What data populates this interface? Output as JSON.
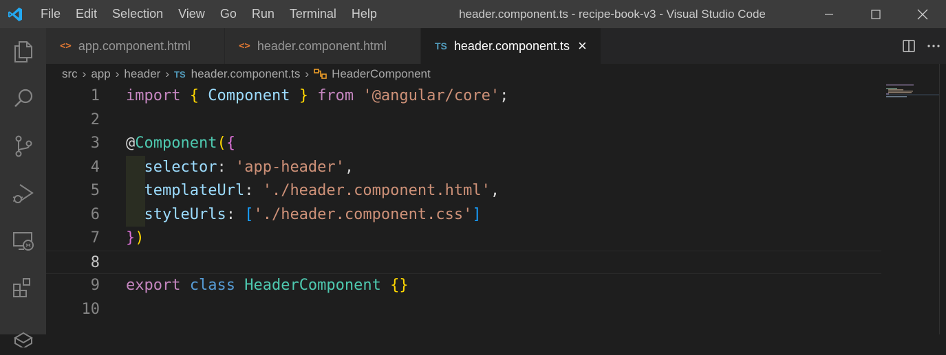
{
  "titlebar": {
    "menu": [
      "File",
      "Edit",
      "Selection",
      "View",
      "Go",
      "Run",
      "Terminal",
      "Help"
    ],
    "window_title": "header.component.ts - recipe-book-v3 - Visual Studio Code"
  },
  "activity_bar": {
    "icons": [
      "explorer-icon",
      "search-icon",
      "source-control-icon",
      "run-debug-icon",
      "remote-explorer-icon",
      "extensions-icon",
      "docker-icon"
    ]
  },
  "tabs": [
    {
      "label": "app.component.html",
      "icon_text": "<>",
      "active": false
    },
    {
      "label": "header.component.html",
      "icon_text": "<>",
      "active": false
    },
    {
      "label": "header.component.ts",
      "icon_text": "TS",
      "active": true
    }
  ],
  "breadcrumbs": {
    "items": [
      "src",
      "app",
      "header",
      "header.component.ts",
      "HeaderComponent"
    ],
    "ts_badge": "TS"
  },
  "editor": {
    "line_numbers": [
      "1",
      "2",
      "3",
      "4",
      "5",
      "6",
      "7",
      "8",
      "9",
      "10"
    ],
    "current_line": 8,
    "tokens": {
      "l1_import": "import",
      "l1_open": "{",
      "l1_component": " Component ",
      "l1_close": "}",
      "l1_from": "from",
      "l1_module": "'@angular/core'",
      "l1_semi": ";",
      "l3_at": "@",
      "l3_decorator": "Component",
      "l3_paren": "(",
      "l3_brace": "{",
      "l4_key": "selector",
      "l4_colon": ": ",
      "l4_val": "'app-header'",
      "l4_comma": ",",
      "l5_key": "templateUrl",
      "l5_colon": ": ",
      "l5_val": "'./header.component.html'",
      "l5_comma": ",",
      "l6_key": "styleUrls",
      "l6_colon": ": ",
      "l6_open": "[",
      "l6_val": "'./header.component.css'",
      "l6_close": "]",
      "l7_brace": "}",
      "l7_paren": ")",
      "l9_export": "export",
      "l9_class": "class",
      "l9_name": "HeaderComponent",
      "l9_braces": "{}"
    }
  },
  "colors": {
    "titlebar": "#3c3c3c",
    "activity_bar": "#333333",
    "editor_bg": "#1e1e1e",
    "accent_vscode": "#23a9f2"
  }
}
